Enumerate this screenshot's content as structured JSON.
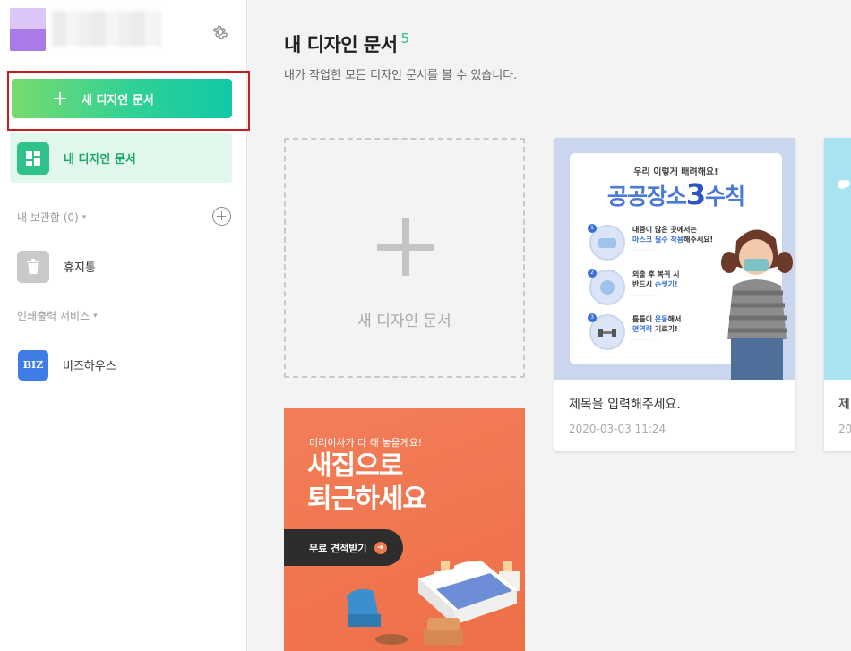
{
  "sidebar": {
    "new_button_label": "새 디자인 문서",
    "items": [
      {
        "label": "내 디자인 문서",
        "icon": "grid-icon"
      },
      {
        "label": "휴지통",
        "icon": "trash-icon"
      },
      {
        "label": "비즈하우스",
        "icon": "biz-logo",
        "logo_text": "BIZ"
      }
    ],
    "storage_label": "내 보관함 (0)",
    "print_label": "인쇄출력 서비스"
  },
  "main": {
    "title": "내 디자인 문서",
    "count": "5",
    "subtitle": "내가 작업한 모든 디자인 문서를 볼 수 있습니다.",
    "new_card_label": "새 디자인 문서",
    "docs": [
      {
        "title": "제목을 입력해주세요.",
        "date": "2020-03-03 11:24",
        "thumb": {
          "small": "우리 이렇게 배려해요!",
          "big_a": "공공장소",
          "big_num": "3",
          "big_b": "수칙",
          "rows": [
            {
              "num": "1",
              "line1": "대중이 많은 곳에서는",
              "line2_hl": "마스크 필수 착용",
              "line2_rest": "해주세요!"
            },
            {
              "num": "2",
              "line1": "외출 후 복귀 시",
              "line2_plain": "반드시 ",
              "line2_hl": "손씻기!"
            },
            {
              "num": "3",
              "line1_plain": "틈틈이 ",
              "line1_hl": "운동",
              "line1_rest": "해서",
              "line2_hl": "면역력",
              "line2_rest": " 기르기!"
            }
          ]
        }
      },
      {
        "title": "제",
        "date": "20"
      },
      {
        "thumb": {
          "sub": "미리이사가 다 해 놓을게요!",
          "title_line1": "새집으로",
          "title_line2": "퇴근하세요",
          "cta": "무료 견적받기"
        }
      }
    ]
  },
  "colors": {
    "accent": "#2fc38a",
    "button_gradient_start": "#78db6e",
    "button_gradient_end": "#12c8a6",
    "highlight_border": "#c41e1e",
    "orange_thumb": "#f07650"
  }
}
